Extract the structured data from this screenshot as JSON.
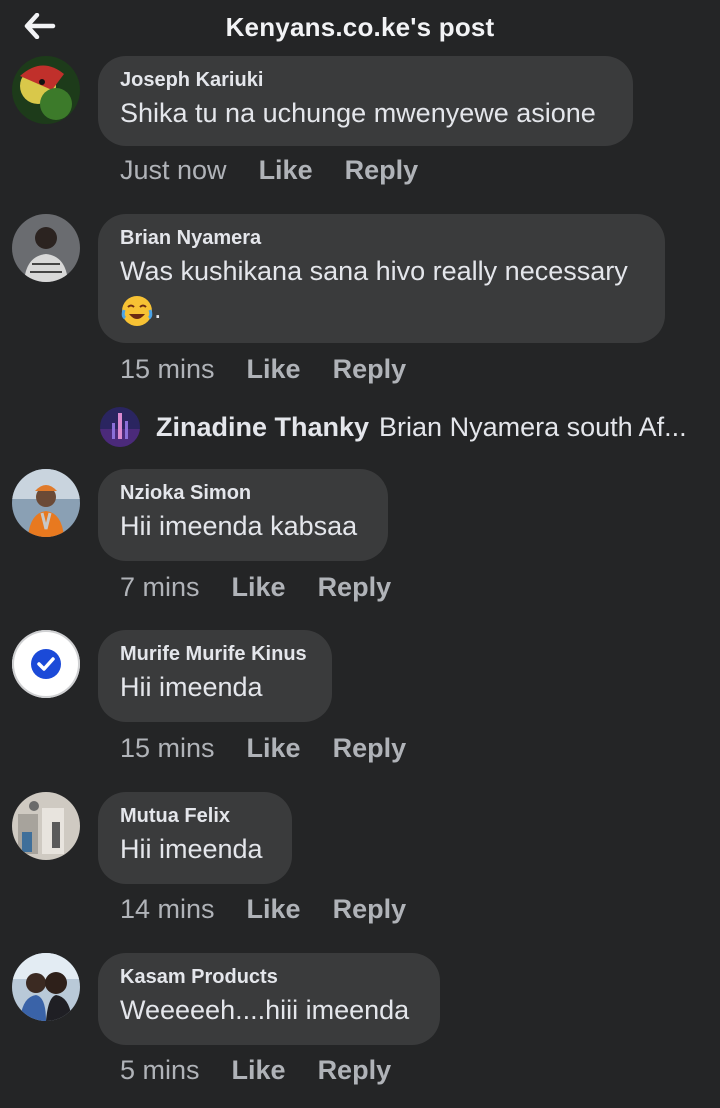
{
  "header": {
    "title": "Kenyans.co.ke's post",
    "back_icon": "arrow-left-icon"
  },
  "comments": [
    {
      "author": "Joseph Kariuki",
      "text": "Shika tu na uchunge mwenyewe asione",
      "time": "Just now",
      "like": "Like",
      "reply": "Reply"
    },
    {
      "author": "Brian Nyamera",
      "text": "Was kushikana sana hivo really necessary",
      "text2": ".",
      "emoji": "joy-emoji-icon",
      "time": "15 mins",
      "like": "Like",
      "reply": "Reply"
    },
    {
      "author": "Nzioka Simon",
      "text": "Hii imeenda kabsaa",
      "time": "7 mins",
      "like": "Like",
      "reply": "Reply"
    },
    {
      "author": "Murife Murife Kinus",
      "text": "Hii imeenda",
      "time": "15 mins",
      "like": "Like",
      "reply": "Reply"
    },
    {
      "author": "Mutua Felix",
      "text": "Hii imeenda",
      "time": "14 mins",
      "like": "Like",
      "reply": "Reply"
    },
    {
      "author": "Kasam Products",
      "text": "Weeeeeh....hiii imeenda",
      "time": "5 mins",
      "like": "Like",
      "reply": "Reply"
    }
  ],
  "reply_preview": {
    "author": "Zinadine Thanky",
    "text": "Brian Nyamera south Af..."
  },
  "colors": {
    "background": "#242526",
    "bubble": "#3a3b3c",
    "text": "#e4e6eb",
    "muted": "#b0b3b8",
    "check_blue": "#1b4ad8"
  }
}
